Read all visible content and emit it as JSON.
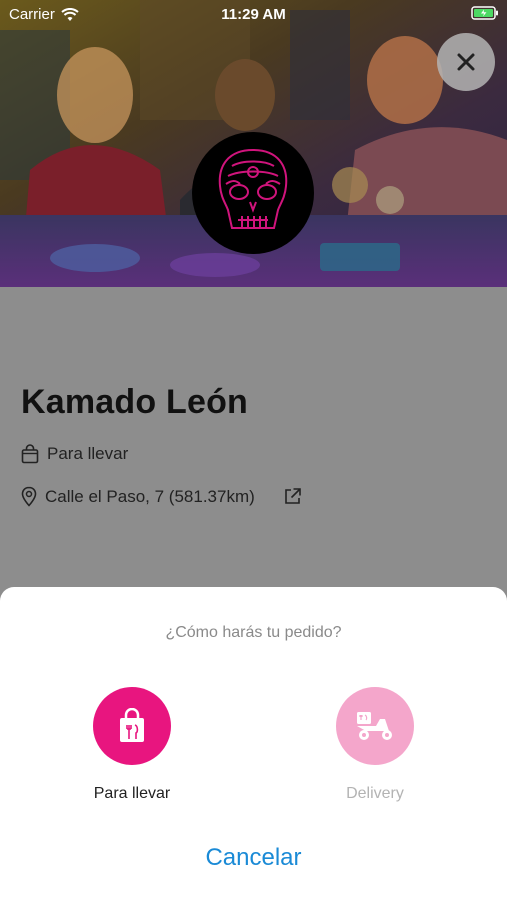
{
  "status_bar": {
    "carrier": "Carrier",
    "time": "11:29 AM"
  },
  "restaurant": {
    "name": "Kamado León",
    "service": "Para llevar",
    "address": "Calle el Paso, 7 (581.37km)"
  },
  "sheet": {
    "question": "¿Cómo harás tu pedido?",
    "options": [
      {
        "label": "Para llevar",
        "icon": "shopping-bag-icon",
        "enabled": true
      },
      {
        "label": "Delivery",
        "icon": "delivery-scooter-icon",
        "enabled": false
      }
    ],
    "cancel_label": "Cancelar"
  },
  "colors": {
    "accent_magenta": "#e8157f",
    "accent_magenta_light": "#f4a6cb",
    "cancel_blue": "#1a8ad6",
    "overlay_gray": "#8d8d8d"
  }
}
